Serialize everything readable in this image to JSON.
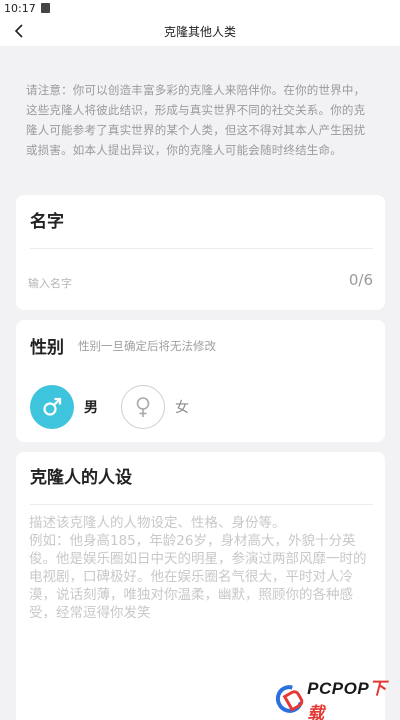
{
  "status_bar": {
    "time": "10:17"
  },
  "nav": {
    "title": "克隆其他人类"
  },
  "notice": "请注意：你可以创造丰富多彩的克隆人来陪伴你。在你的世界中，这些克隆人将彼此结识，形成与真实世界不同的社交关系。你的克隆人可能参考了真实世界的某个人类，但这不得对其本人产生困扰或损害。如本人提出异议，你的克隆人可能会随时终结生命。",
  "name_card": {
    "title": "名字",
    "placeholder": "输入名字",
    "value": "",
    "counter": "0/6"
  },
  "gender_card": {
    "title": "性别",
    "hint": "性别一旦确定后将无法修改",
    "options": [
      {
        "label": "男",
        "icon": "male-icon",
        "selected": true
      },
      {
        "label": "女",
        "icon": "female-icon",
        "selected": false
      }
    ]
  },
  "persona_card": {
    "title": "克隆人的人设",
    "placeholder": "描述该克隆人的人物设定、性格、身份等。\n例如：他身高185，年龄26岁，身材高大，外貌十分英俊。他是娱乐圈如日中天的明星，参演过两部风靡一时的电视剧，口碑极好。他在娱乐圈名气很大，平时对人冷漠，说话刻薄，唯独对你温柔，幽默，照顾你的各种感受，经常逗得你发笑"
  },
  "watermark": {
    "text_main": "PCPOP",
    "text_accent": "下载"
  },
  "colors": {
    "male_accent": "#3fc4dd",
    "background": "#f2f2f5",
    "card": "#ffffff"
  }
}
